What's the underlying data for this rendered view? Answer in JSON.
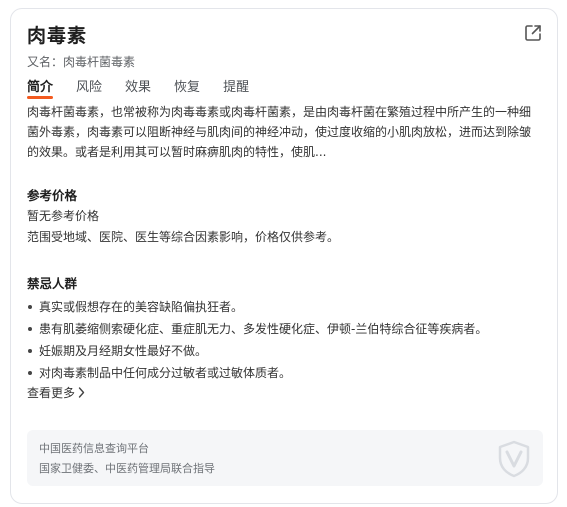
{
  "header": {
    "title": "肉毒素",
    "alias": "又名：肉毒杆菌毒素",
    "open_icon": "external-link-icon"
  },
  "tabs": [
    {
      "label": "简介",
      "active": true
    },
    {
      "label": "风险",
      "active": false
    },
    {
      "label": "效果",
      "active": false
    },
    {
      "label": "恢复",
      "active": false
    },
    {
      "label": "提醒",
      "active": false
    }
  ],
  "summary": "肉毒杆菌毒素，也常被称为肉毒毒素或肉毒杆菌素，是由肉毒杆菌在繁殖过程中所产生的一种细菌外毒素，肉毒素可以阻断神经与肌肉间的神经冲动，使过度收缩的小肌肉放松，进而达到除皱的效果。或者是利用其可以暂时麻痹肌肉的特性，使肌...",
  "price": {
    "heading": "参考价格",
    "line1": "暂无参考价格",
    "line2": "范围受地域、医院、医生等综合因素影响，价格仅供参考。"
  },
  "contra": {
    "heading": "禁忌人群",
    "items": [
      "真实或假想存在的美容缺陷偏执狂者。",
      "患有肌萎缩侧索硬化症、重症肌无力、多发性硬化症、伊顿-兰伯特综合征等疾病者。",
      "妊娠期及月经期女性最好不做。",
      "对肉毒素制品中任何成分过敏者或过敏体质者。"
    ]
  },
  "more_label": "查看更多",
  "footer": {
    "line1": "中国医药信息查询平台",
    "line2": "国家卫健委、中医药管理局联合指导",
    "icon": "shield-v-icon"
  }
}
